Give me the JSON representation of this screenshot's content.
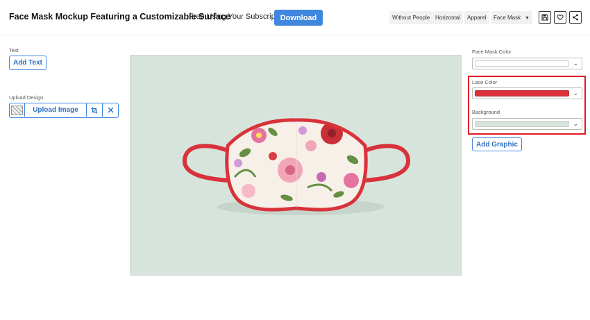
{
  "header": {
    "title": "Face Mask Mockup Featuring a Customizable Surface",
    "subline": "Free Using Your Subscription!",
    "download_label": "Download",
    "tags": [
      "Without People",
      "Horizontal",
      "Apparel",
      "Face Mask"
    ],
    "more_tags_icon": "caret-down-icon",
    "actions": [
      "save-icon",
      "heart-icon",
      "share-icon"
    ]
  },
  "left_panel": {
    "text_label": "Text",
    "add_text_label": "Add Text",
    "upload_label": "Upload Design",
    "upload_image_label": "Upload Image"
  },
  "right_panel": {
    "face_mask_color_label": "Face Mask Color",
    "face_mask_color": "#ffffff",
    "lace_color_label": "Lace Color",
    "lace_color": "#d8323a",
    "background_label": "Background",
    "background_color": "#d7e4dc",
    "add_graphic_label": "Add Graphic",
    "highlight_color": "#e11b22"
  },
  "colors": {
    "accent": "#3f86de",
    "canvas_bg": "#d7e4dc"
  }
}
